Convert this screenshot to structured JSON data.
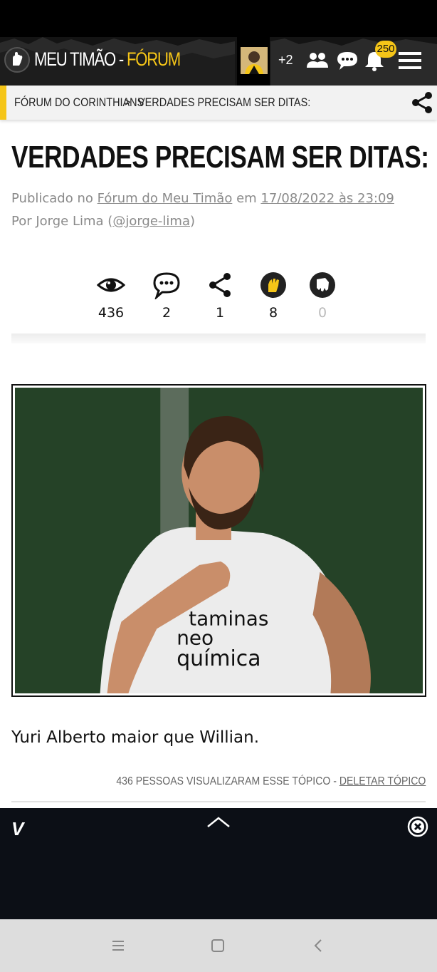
{
  "header": {
    "title_main": "MEU TIMÃO",
    "title_separator": " - ",
    "title_accent": "FÓRUM",
    "online_extra": "+2",
    "notifications_count": "250",
    "accent_color": "#f5c518"
  },
  "breadcrumb": {
    "root": "FÓRUM DO CORINTHIANS",
    "separator": ">",
    "current": "VERDADES PRECISAM SER DITAS:"
  },
  "post": {
    "title": "VERDADES PRECISAM SER DITAS:",
    "published_prefix": "Publicado no",
    "forum_link": "Fórum do Meu Timão",
    "date_prefix": "em",
    "date": "17/08/2022 às 23:09",
    "author_prefix": "Por Jorge Lima (",
    "author_handle": "@jorge-lima",
    "author_suffix": ")",
    "body": "Yuri Alberto maior que Willian."
  },
  "stats": {
    "views": "436",
    "comments": "2",
    "shares": "1",
    "likes": "8",
    "dislikes": "0"
  },
  "footer": {
    "views_text": "436 PESSOAS VISUALIZARAM ESSE TÓPICO - ",
    "delete_link": "DELETAR TÓPICO"
  },
  "ad": {
    "logo": "V"
  },
  "icons": {
    "header": [
      "fist-logo-icon",
      "users-icon",
      "chat-icon",
      "bell-icon",
      "menu-icon"
    ],
    "stats": [
      "eye-icon",
      "comment-icon",
      "share-icon",
      "fist-up-icon",
      "fist-down-icon"
    ]
  }
}
